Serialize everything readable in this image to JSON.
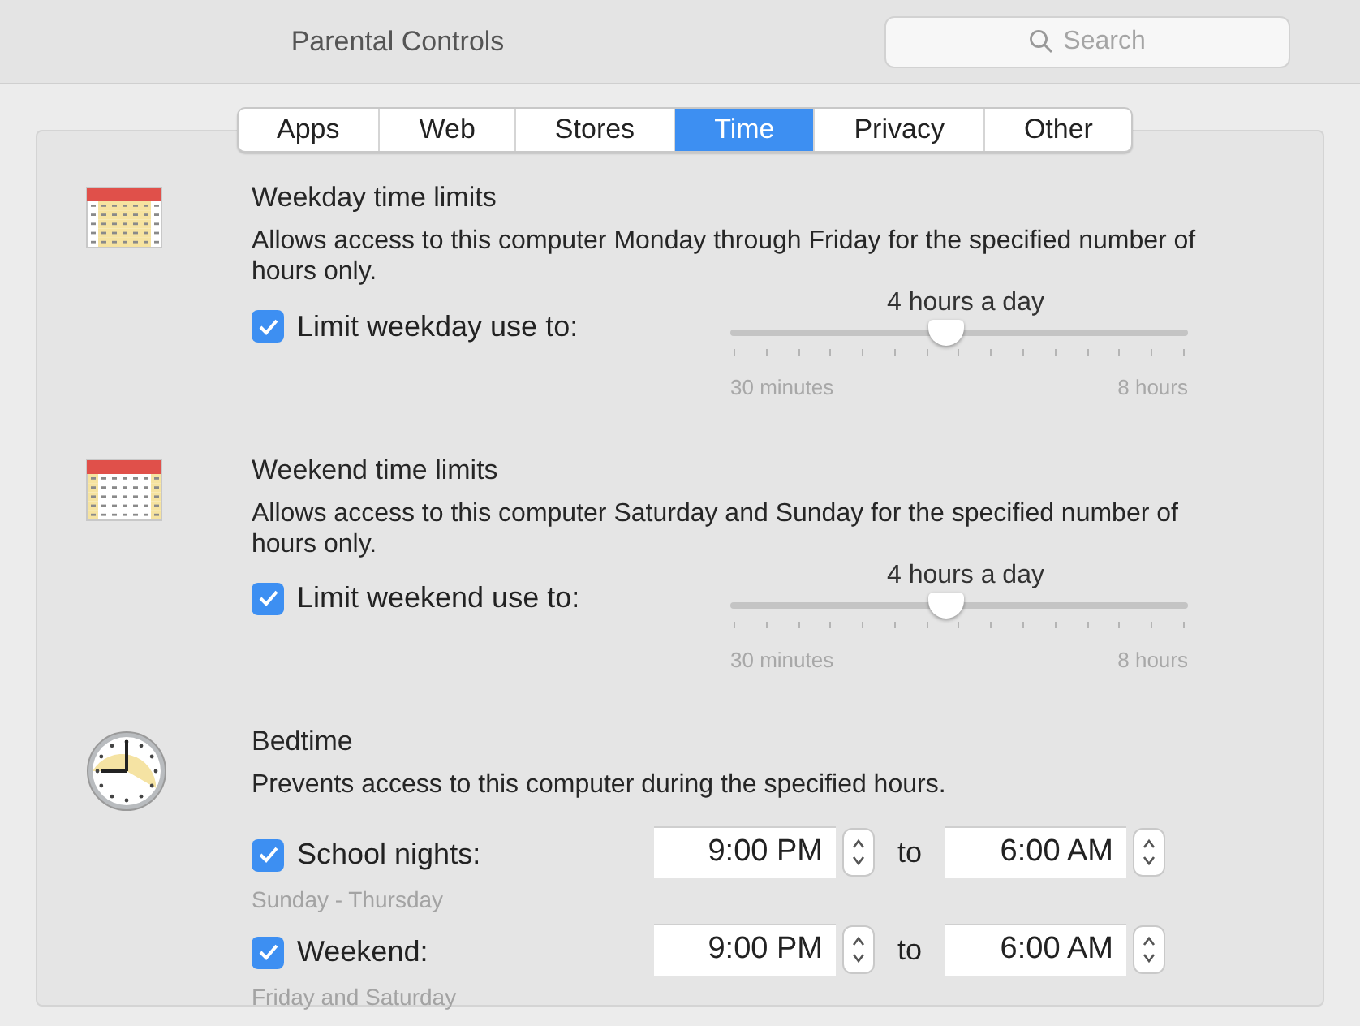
{
  "window": {
    "title": "Parental Controls"
  },
  "search": {
    "placeholder": "Search"
  },
  "tabs": [
    {
      "label": "Apps",
      "selected": false
    },
    {
      "label": "Web",
      "selected": false
    },
    {
      "label": "Stores",
      "selected": false
    },
    {
      "label": "Time",
      "selected": true
    },
    {
      "label": "Privacy",
      "selected": false
    },
    {
      "label": "Other",
      "selected": false
    }
  ],
  "sections": [
    {
      "kind": "weekday",
      "title": "Weekday time limits",
      "description": "Allows access to this computer Monday through Friday for the specified number of hours only.",
      "checkbox": {
        "label": "Limit weekday use to:",
        "checked": true
      },
      "slider": {
        "reading": "4 hours a day",
        "level": 0.47,
        "min_label": "30 minutes",
        "max_label": "8 hours"
      }
    },
    {
      "kind": "weekend",
      "title": "Weekend time limits",
      "description": "Allows access to this computer Saturday and Sunday for the specified number of hours only.",
      "checkbox": {
        "label": "Limit weekend use to:",
        "checked": true
      },
      "slider": {
        "reading": "4 hours a day",
        "level": 0.47,
        "min_label": "30 minutes",
        "max_label": "8 hours"
      }
    },
    {
      "kind": "bedtime",
      "title": "Bedtime",
      "description": "Prevents access to this computer during the specified hours.",
      "rows": [
        {
          "label": "School nights:",
          "checked": true,
          "days": "Sunday - Thursday",
          "from": "9:00 PM",
          "to_word": "to",
          "to": "6:00 AM"
        },
        {
          "label": "Weekend:",
          "checked": true,
          "days": "Friday and Saturday",
          "from": "9:00 PM",
          "to_word": "to",
          "to": "6:00 AM"
        }
      ]
    }
  ]
}
